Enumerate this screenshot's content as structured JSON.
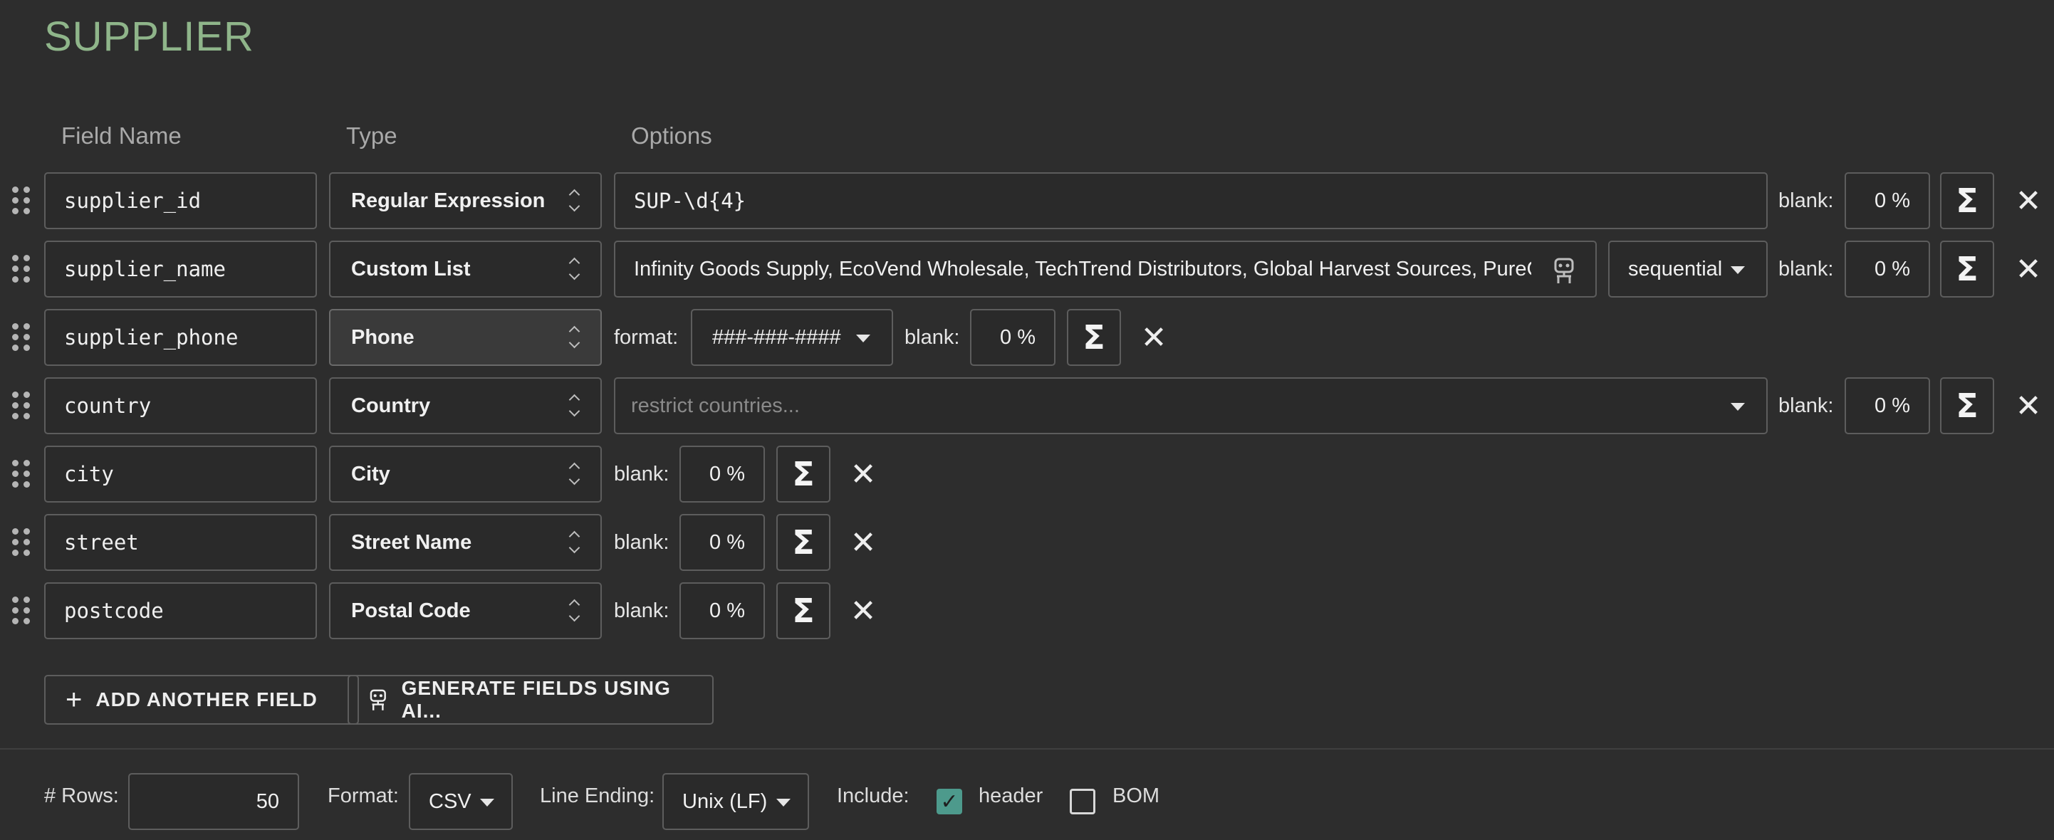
{
  "table_title": "SUPPLIER",
  "columns": {
    "field_name": "Field Name",
    "type": "Type",
    "options": "Options"
  },
  "common": {
    "blank_label": "blank:",
    "sigma_symbol": "Σ",
    "delete_symbol": "✕",
    "format_label": "format:"
  },
  "rows": [
    {
      "name": "supplier_id",
      "type": "Regular Expression",
      "option_value": "SUP-\\d{4}",
      "blank": "0 %"
    },
    {
      "name": "supplier_name",
      "type": "Custom List",
      "option_value": "Infinity Goods Supply, EcoVend Wholesale, TechTrend Distributors, Global Harvest Sources, PureCraft",
      "order": "sequential",
      "blank": "0 %"
    },
    {
      "name": "supplier_phone",
      "type": "Phone",
      "format": "###-###-####",
      "blank": "0 %"
    },
    {
      "name": "country",
      "type": "Country",
      "placeholder": "restrict countries...",
      "blank": "0 %"
    },
    {
      "name": "city",
      "type": "City",
      "blank": "0 %"
    },
    {
      "name": "street",
      "type": "Street Name",
      "blank": "0 %"
    },
    {
      "name": "postcode",
      "type": "Postal Code",
      "blank": "0 %"
    }
  ],
  "actions": {
    "add_field": "ADD ANOTHER FIELD",
    "generate_ai": "GENERATE FIELDS USING AI..."
  },
  "footer": {
    "rows_label": "# Rows:",
    "rows_value": "50",
    "format_label": "Format:",
    "format_value": "CSV",
    "line_ending_label": "Line Ending:",
    "line_ending_value": "Unix (LF)",
    "include_label": "Include:",
    "header_label": "header",
    "header_checked": true,
    "bom_label": "BOM",
    "bom_checked": false
  },
  "colors": {
    "title": "#8fb58a",
    "background": "#2d2d2d",
    "checkbox_accent": "#4d9a8c"
  }
}
